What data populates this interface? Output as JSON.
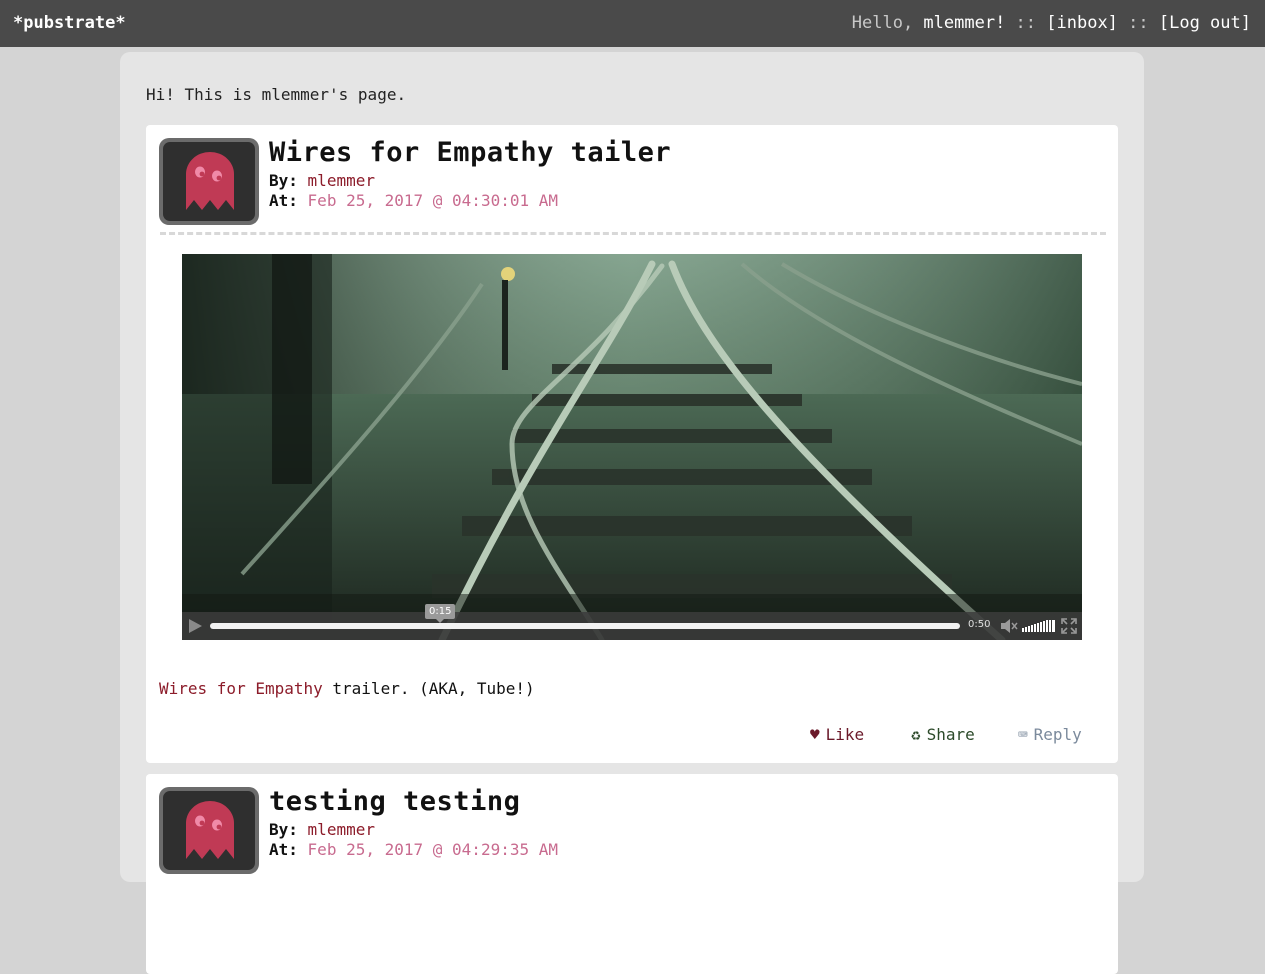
{
  "topbar": {
    "brand": "*pubstrate*",
    "greeting": "Hello, ",
    "username": "mlemmer!",
    "sep1": " :: ",
    "inbox": "[inbox]",
    "sep2": " :: ",
    "logout": "[Log out]"
  },
  "page": {
    "intro": "Hi! This is mlemmer's page."
  },
  "posts": [
    {
      "title": "Wires for Empathy tailer",
      "by_label": "By:",
      "author": "mlemmer",
      "at_label": "At:",
      "date": "Feb 25, 2017 @ 04:30:01 AM",
      "video": {
        "tooltip_time": "0:15",
        "duration": "0:50",
        "progress_fraction": 0.3
      },
      "caption_link": "Wires for Empathy",
      "caption_rest": " trailer. (AKA, Tube!)",
      "actions": {
        "like_icon": "♥",
        "like": "Like",
        "share_icon": "♻",
        "share": "Share",
        "reply_icon": "⌨",
        "reply": "Reply"
      }
    },
    {
      "title": "testing testing",
      "by_label": "By:",
      "author": "mlemmer",
      "at_label": "At:",
      "date": "Feb 25, 2017 @ 04:29:35 AM"
    }
  ],
  "colors": {
    "topbar": "#4a4a4a",
    "author": "#8c1c2a",
    "date": "#c86b8f",
    "ghost": "#c03a55"
  }
}
